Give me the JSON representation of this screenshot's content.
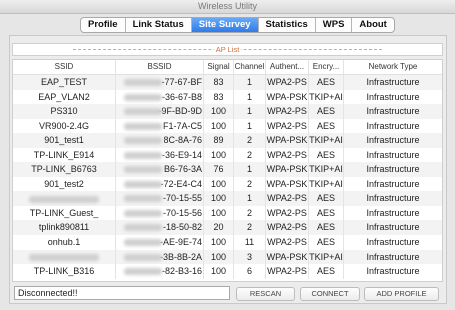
{
  "window": {
    "title": "Wireless Utility"
  },
  "tabs": [
    "Profile",
    "Link Status",
    "Site Survey",
    "Statistics",
    "WPS",
    "About"
  ],
  "active_tab": "Site Survey",
  "ap_list": {
    "label": "AP List",
    "columns": [
      "SSID",
      "BSSID",
      "Signal",
      "Channel",
      "Authent...",
      "Encry...",
      "Network Type"
    ],
    "rows": [
      {
        "ssid": "EAP_TEST",
        "bssid": "-77-67-BF",
        "signal": "83",
        "channel": "1",
        "auth": "WPA2-PS",
        "enc": "AES",
        "type": "Infrastructure"
      },
      {
        "ssid": "EAP_VLAN2",
        "bssid": "-36-67-B8",
        "signal": "83",
        "channel": "1",
        "auth": "WPA-PSK",
        "enc": "TKIP+AI",
        "type": "Infrastructure"
      },
      {
        "ssid": "PS310",
        "bssid": "-9F-BD-9D",
        "signal": "100",
        "channel": "1",
        "auth": "WPA2-PS",
        "enc": "AES",
        "type": "Infrastructure"
      },
      {
        "ssid": "VR900-2.4G",
        "bssid": "F1-7A-C5",
        "signal": "100",
        "channel": "1",
        "auth": "WPA2-PS",
        "enc": "AES",
        "type": "Infrastructure"
      },
      {
        "ssid": "901_test1",
        "bssid": "8C-8A-76",
        "signal": "89",
        "channel": "2",
        "auth": "WPA-PSK",
        "enc": "TKIP+AI",
        "type": "Infrastructure"
      },
      {
        "ssid": "TP-LINK_E914",
        "bssid": "-36-E9-14",
        "signal": "100",
        "channel": "2",
        "auth": "WPA2-PS",
        "enc": "AES",
        "type": "Infrastructure"
      },
      {
        "ssid": "TP-LINK_B6763",
        "bssid": "B6-76-3A",
        "signal": "76",
        "channel": "1",
        "auth": "WPA-PSK",
        "enc": "TKIP+AI",
        "type": "Infrastructure"
      },
      {
        "ssid": "901_test2",
        "bssid": "-72-E4-C4",
        "signal": "100",
        "channel": "2",
        "auth": "WPA-PSK",
        "enc": "TKIP+AI",
        "type": "Infrastructure"
      },
      {
        "ssid": "",
        "bssid": "-70-15-55",
        "signal": "100",
        "channel": "1",
        "auth": "WPA2-PS",
        "enc": "AES",
        "type": "Infrastructure"
      },
      {
        "ssid": "TP-LINK_Guest_",
        "bssid": "-70-15-56",
        "signal": "100",
        "channel": "2",
        "auth": "WPA2-PS",
        "enc": "AES",
        "type": "Infrastructure"
      },
      {
        "ssid": "tplink890811",
        "bssid": "-18-50-82",
        "signal": "20",
        "channel": "2",
        "auth": "WPA2-PS",
        "enc": "AES",
        "type": "Infrastructure"
      },
      {
        "ssid": "onhub.1",
        "bssid": "-AE-9E-74",
        "signal": "100",
        "channel": "11",
        "auth": "WPA2-PS",
        "enc": "AES",
        "type": "Infrastructure"
      },
      {
        "ssid": "",
        "bssid": "-3B-8B-2A",
        "signal": "100",
        "channel": "3",
        "auth": "WPA-PSK",
        "enc": "TKIP+AI",
        "type": "Infrastructure"
      },
      {
        "ssid": "TP-LINK_B316",
        "bssid": "-82-B3-16",
        "signal": "100",
        "channel": "6",
        "auth": "WPA2-PS",
        "enc": "AES",
        "type": "Infrastructure"
      }
    ]
  },
  "status": {
    "text": "Disconnected!!"
  },
  "buttons": {
    "rescan": "RESCAN",
    "connect": "CONNECT",
    "add_profile": "ADD PROFILE"
  },
  "colors": {
    "accent": "#2f7be9",
    "ap_label": "#d0703a"
  }
}
